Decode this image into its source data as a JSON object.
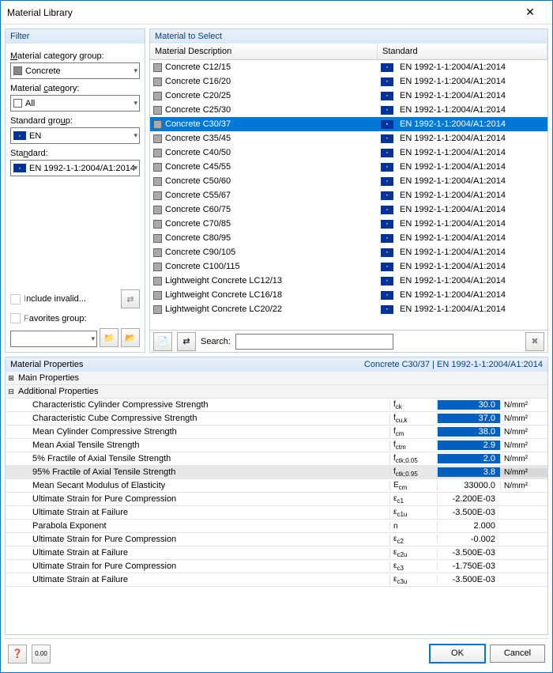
{
  "window": {
    "title": "Material Library"
  },
  "filter": {
    "header": "Filter",
    "catGroupLabel": "Material category group:",
    "catGroup": "Concrete",
    "catLabel": "Material category:",
    "cat": "All",
    "stdGroupLabel": "Standard group:",
    "stdGroup": "EN",
    "stdLabel": "Standard:",
    "std": "EN 1992-1-1:2004/A1:2014",
    "includeInvalid": "Include invalid...",
    "favGroup": "Favorites group:"
  },
  "select": {
    "header": "Material to Select",
    "colDesc": "Material Description",
    "colStd": "Standard",
    "std": "EN 1992-1-1:2004/A1:2014",
    "searchLabel": "Search:",
    "searchValue": "",
    "rows": [
      {
        "desc": "Concrete C12/15"
      },
      {
        "desc": "Concrete C16/20"
      },
      {
        "desc": "Concrete C20/25"
      },
      {
        "desc": "Concrete C25/30"
      },
      {
        "desc": "Concrete C30/37",
        "sel": true
      },
      {
        "desc": "Concrete C35/45"
      },
      {
        "desc": "Concrete C40/50"
      },
      {
        "desc": "Concrete C45/55"
      },
      {
        "desc": "Concrete C50/60"
      },
      {
        "desc": "Concrete C55/67"
      },
      {
        "desc": "Concrete C60/75"
      },
      {
        "desc": "Concrete C70/85"
      },
      {
        "desc": "Concrete C80/95"
      },
      {
        "desc": "Concrete C90/105"
      },
      {
        "desc": "Concrete C100/115"
      },
      {
        "desc": "Lightweight Concrete LC12/13"
      },
      {
        "desc": "Lightweight Concrete LC16/18"
      },
      {
        "desc": "Lightweight Concrete LC20/22"
      }
    ]
  },
  "props": {
    "header": "Material Properties",
    "headerRight": "Concrete C30/37  |  EN 1992-1-1:2004/A1:2014",
    "mainProps": "Main Properties",
    "addProps": "Additional Properties",
    "rows": [
      {
        "name": "Characteristic Cylinder Compressive Strength",
        "sym": "f ck",
        "val": "30.0",
        "unit": "N/mm²",
        "blue": true
      },
      {
        "name": "Characteristic Cube Compressive Strength",
        "sym": "f cu,k",
        "val": "37.0",
        "unit": "N/mm²",
        "blue": true
      },
      {
        "name": "Mean Cylinder Compressive Strength",
        "sym": "f cm",
        "val": "38.0",
        "unit": "N/mm²",
        "blue": true
      },
      {
        "name": "Mean Axial Tensile Strength",
        "sym": "f ctm",
        "val": "2.9",
        "unit": "N/mm²",
        "blue": true
      },
      {
        "name": "5% Fractile of Axial Tensile Strength",
        "sym": "f ctk;0.05",
        "val": "2.0",
        "unit": "N/mm²",
        "blue": true
      },
      {
        "name": "95% Fractile of Axial Tensile Strength",
        "sym": "f ctk;0.95",
        "val": "3.8",
        "unit": "N/mm²",
        "blue": true,
        "hl": true
      },
      {
        "name": "Mean Secant Modulus of Elasticity",
        "sym": "E cm",
        "val": "33000.0",
        "unit": "N/mm²"
      },
      {
        "name": "Ultimate Strain for Pure Compression",
        "sym": "ε c1",
        "val": "-2.200E-03",
        "unit": ""
      },
      {
        "name": "Ultimate Strain at Failure",
        "sym": "ε c1u",
        "val": "-3.500E-03",
        "unit": ""
      },
      {
        "name": "Parabola Exponent",
        "sym": "n",
        "val": "2.000",
        "unit": ""
      },
      {
        "name": "Ultimate Strain for Pure Compression",
        "sym": "ε c2",
        "val": "-0.002",
        "unit": ""
      },
      {
        "name": "Ultimate Strain at Failure",
        "sym": "ε c2u",
        "val": "-3.500E-03",
        "unit": ""
      },
      {
        "name": "Ultimate Strain for Pure Compression",
        "sym": "ε c3",
        "val": "-1.750E-03",
        "unit": ""
      },
      {
        "name": "Ultimate Strain at Failure",
        "sym": "ε c3u",
        "val": "-3.500E-03",
        "unit": ""
      }
    ]
  },
  "buttons": {
    "ok": "OK",
    "cancel": "Cancel"
  }
}
